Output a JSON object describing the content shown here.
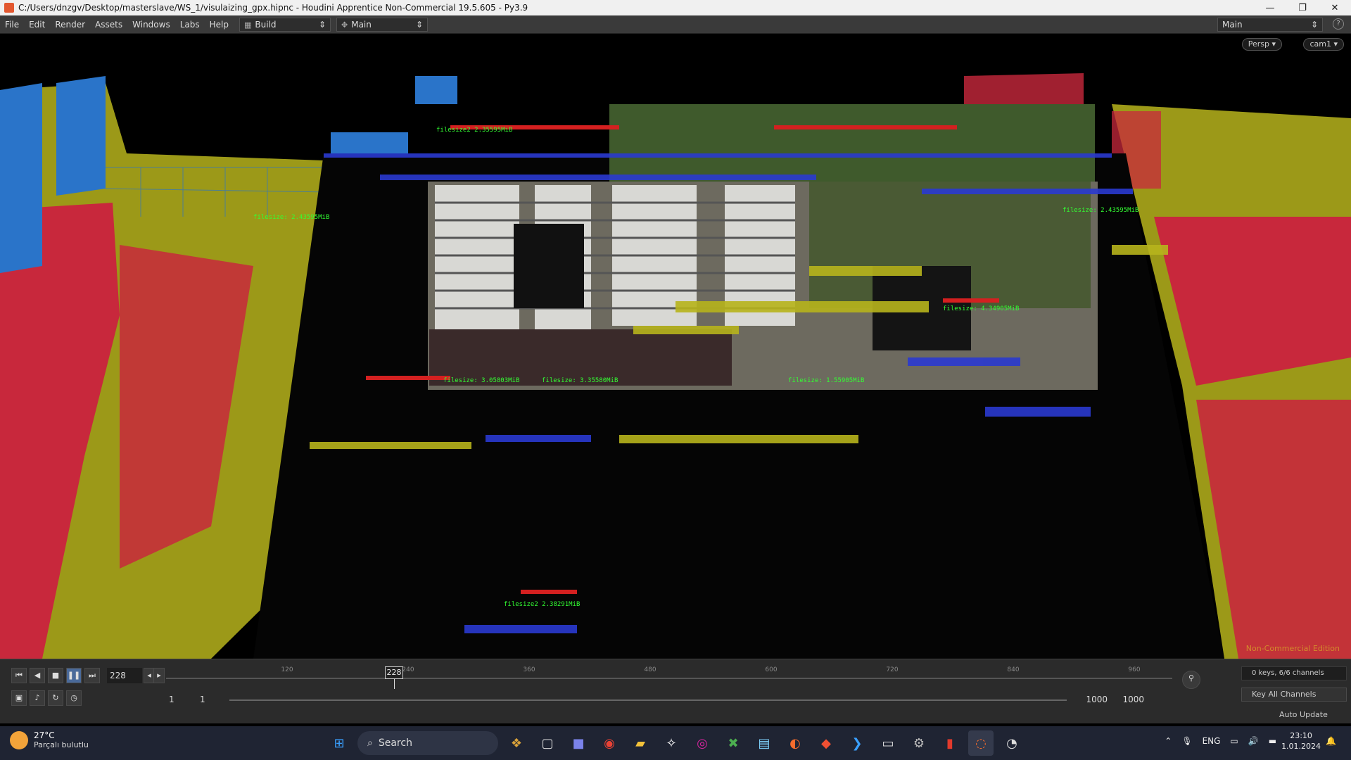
{
  "window": {
    "title": "C:/Users/dnzgv/Desktop/masterslave/WS_1/visulaizing_gpx.hipnc - Houdini Apprentice Non-Commercial 19.5.605 - Py3.9",
    "minimize": "—",
    "maximize": "❐",
    "close": "✕"
  },
  "menu": {
    "items": [
      "File",
      "Edit",
      "Render",
      "Assets",
      "Windows",
      "Labs",
      "Help"
    ],
    "desktop_left": "Build",
    "desktop_left2": "Main",
    "desktop_right": "Main",
    "help_icon": "?"
  },
  "viewport": {
    "persp_button": "Persp ▾",
    "cam_button": "cam1 ▾",
    "watermark": "Non-Commercial Edition"
  },
  "playbar": {
    "current_frame": "228",
    "cursor_frame": "228",
    "tick_labels": [
      "120",
      "240",
      "360",
      "480",
      "600",
      "720",
      "840",
      "960"
    ],
    "range_start": "1",
    "range_start2": "1",
    "range_end": "1000",
    "range_end2": "1000",
    "keys_status": "0 keys, 6/6 channels",
    "key_all_channels": "Key All Channels",
    "auto_update": "Auto Update"
  },
  "taskbar": {
    "temperature": "27°C",
    "weather_text": "Parçalı bulutlu",
    "search_label": "Search",
    "language": "ENG",
    "time": "23:10",
    "date": "1.01.2024"
  },
  "colors": {
    "titlebar_bg": "#f0f0f0",
    "menubar_bg": "#3a3a3a",
    "playbar_bg": "#2b2b2b",
    "taskbar_bg": "#1f2433",
    "accent_red": "#c8283c",
    "accent_yellow": "#b7b41c",
    "accent_blue": "#2a74c9",
    "label_green": "#33ff33",
    "watermark_orange": "#d38a2c"
  },
  "icons": [
    "houdini-app-icon",
    "play-first-icon",
    "play-back-icon",
    "stop-icon",
    "pause-icon",
    "play-forward-icon",
    "windows-start-icon",
    "search-icon",
    "chrome-icon",
    "file-explorer-icon",
    "vscode-icon",
    "houdini-taskbar-icon",
    "mic-icon",
    "network-icon",
    "volume-icon",
    "battery-icon",
    "notification-icon"
  ]
}
